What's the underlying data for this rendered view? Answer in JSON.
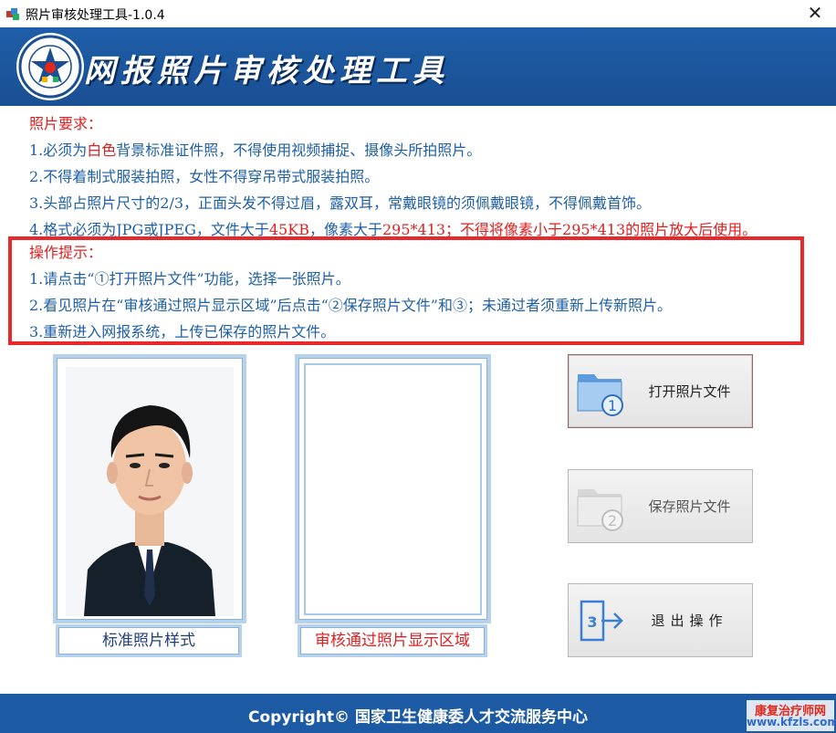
{
  "window": {
    "title": "照片审核处理工具-1.0.4",
    "close_glyph": "✕"
  },
  "header": {
    "title": "网报照片审核处理工具"
  },
  "requirements": {
    "heading": "照片要求：",
    "line1": {
      "a": "1.必须为",
      "b": "白色",
      "c": "背景标准证件照，不得使用视频捕捉、摄像头所拍照片。"
    },
    "line2": "2.不得着制式服装拍照，女性不得穿吊带式服装拍照。",
    "line3": "3.头部占照片尺寸的2/3，正面头发不得过眉，露双耳，常戴眼镜的须佩戴眼镜，不得佩戴首饰。",
    "line4": {
      "a": "4.格式必须为JPG或JPEG，文件大于",
      "b": "45KB",
      "c": "，像素大于",
      "d": "295*413；不得将像素小于295*413的照片放大后使用。"
    }
  },
  "tips": {
    "heading": "操作提示：",
    "line1": "1.请点击“①打开照片文件”功能，选择一张照片。",
    "line2": "2.看见照片在“审核通过照片显示区域”后点击“②保存照片文件”和③；未通过者须重新上传新照片。",
    "line3": "3.重新进入网报系统，上传已保存的照片文件。"
  },
  "panels": {
    "sample_caption": "标准照片样式",
    "result_caption": "审核通过照片显示区域"
  },
  "buttons": {
    "open": {
      "label": "打开照片文件",
      "icon": "folder-1-icon"
    },
    "save": {
      "label": "保存照片文件",
      "icon": "folder-2-icon",
      "enabled": false
    },
    "exit": {
      "label": "退出操作",
      "icon": "exit-3-icon"
    }
  },
  "footer": {
    "copyright": "Copyright© 国家卫生健康委人才交流服务中心"
  },
  "watermark": {
    "line1": "康复治疗师网",
    "line2": "www.kfzls.com"
  },
  "colors": {
    "header_blue": "#1a4f93",
    "text_blue": "#1e5fa5",
    "highlight_red": "#e02020",
    "tip_border": "#e8282b"
  }
}
